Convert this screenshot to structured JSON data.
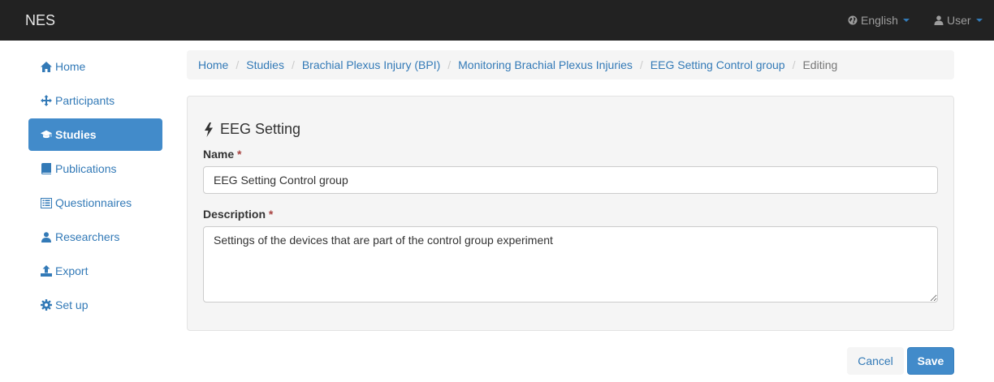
{
  "navbar": {
    "brand": "NES",
    "language_label": "English",
    "user_label": "User"
  },
  "sidebar": {
    "items": [
      {
        "label": "Home",
        "icon": "home-icon",
        "active": false
      },
      {
        "label": "Participants",
        "icon": "move-icon",
        "active": false
      },
      {
        "label": "Studies",
        "icon": "education-icon",
        "active": true
      },
      {
        "label": "Publications",
        "icon": "book-icon",
        "active": false
      },
      {
        "label": "Questionnaires",
        "icon": "list-alt-icon",
        "active": false
      },
      {
        "label": "Researchers",
        "icon": "user-icon",
        "active": false
      },
      {
        "label": "Export",
        "icon": "export-icon",
        "active": false
      },
      {
        "label": "Set up",
        "icon": "cog-icon",
        "active": false
      }
    ]
  },
  "breadcrumb": {
    "links": [
      "Home",
      "Studies",
      "Brachial Plexus Injury (BPI)",
      "Monitoring Brachial Plexus Injuries",
      "EEG Setting Control group"
    ],
    "current": "Editing"
  },
  "form": {
    "title": "EEG Setting",
    "name_label": "Name",
    "name_value": "EEG Setting Control group",
    "description_label": "Description",
    "description_value": "Settings of the devices that are part of the control group experiment",
    "required_mark": "*"
  },
  "buttons": {
    "cancel": "Cancel",
    "save": "Save"
  },
  "colors": {
    "navbar_bg": "#222222",
    "link": "#337ab7",
    "active_bg": "#428bca",
    "required": "#a94442"
  }
}
